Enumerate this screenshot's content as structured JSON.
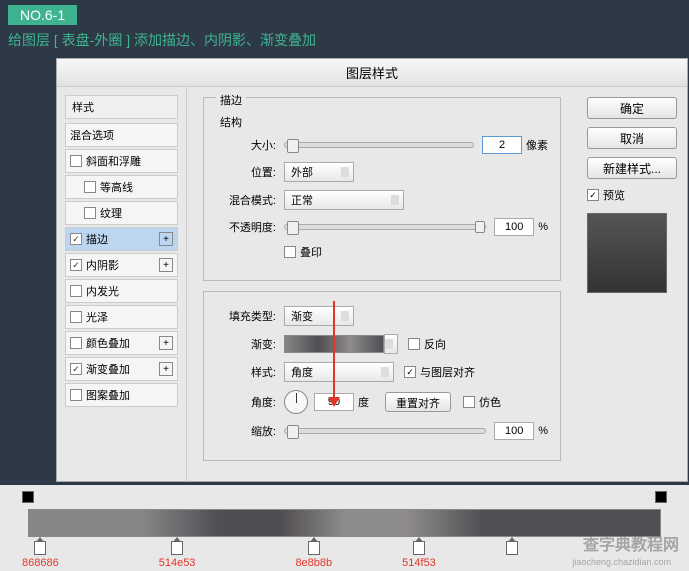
{
  "tag": "NO.6-1",
  "instruction": "给图层 [ 表盘-外圈 ] 添加描边、内阴影、渐变叠加",
  "dialog": {
    "title": "图层样式",
    "left": {
      "styles_title": "样式",
      "blend_options": "混合选项",
      "items": [
        {
          "label": "斜面和浮雕",
          "checked": false,
          "indent": false,
          "plus": false
        },
        {
          "label": "等高线",
          "checked": false,
          "indent": true,
          "plus": false
        },
        {
          "label": "纹理",
          "checked": false,
          "indent": true,
          "plus": false
        },
        {
          "label": "描边",
          "checked": true,
          "indent": false,
          "plus": true,
          "selected": true
        },
        {
          "label": "内阴影",
          "checked": true,
          "indent": false,
          "plus": true
        },
        {
          "label": "内发光",
          "checked": false,
          "indent": false,
          "plus": false
        },
        {
          "label": "光泽",
          "checked": false,
          "indent": false,
          "plus": false
        },
        {
          "label": "颜色叠加",
          "checked": false,
          "indent": false,
          "plus": true
        },
        {
          "label": "渐变叠加",
          "checked": true,
          "indent": false,
          "plus": true
        },
        {
          "label": "图案叠加",
          "checked": false,
          "indent": false,
          "plus": false
        }
      ]
    },
    "center": {
      "group1_title": "描边",
      "structure_title": "结构",
      "size_label": "大小:",
      "size_value": "2",
      "size_unit": "像素",
      "position_label": "位置:",
      "position_value": "外部",
      "blend_label": "混合模式:",
      "blend_value": "正常",
      "opacity_label": "不透明度:",
      "opacity_value": "100",
      "opacity_unit": "%",
      "knockout_label": "叠印",
      "fill_type_label": "填充类型:",
      "fill_type_value": "渐变",
      "gradient_label": "渐变:",
      "reverse_label": "反向",
      "style_label": "样式:",
      "style_value": "角度",
      "align_label": "与图层对齐",
      "angle_label": "角度:",
      "angle_value": "90",
      "angle_unit": "度",
      "reset_btn": "重置对齐",
      "dither_label": "仿色",
      "scale_label": "缩放:",
      "scale_value": "100",
      "scale_unit": "%"
    },
    "right": {
      "ok": "确定",
      "cancel": "取消",
      "new_style": "新建样式...",
      "preview": "预览"
    }
  },
  "gradient": {
    "stops": [
      {
        "color": "868686"
      },
      {
        "color": "514e53"
      },
      {
        "color": "8e8b8b"
      },
      {
        "color": "514f53"
      }
    ]
  },
  "watermark": "查字典教程网",
  "watermark_url": "jiaocheng.chazidian.com"
}
